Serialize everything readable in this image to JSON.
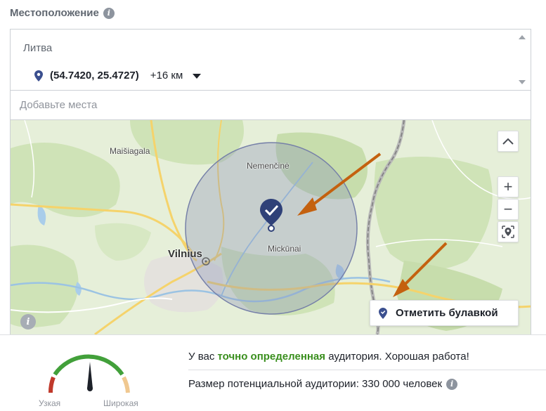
{
  "section": {
    "title": "Местоположение",
    "info_icon": "info-icon"
  },
  "location": {
    "country": "Литва",
    "coords": "(54.7420, 25.4727)",
    "radius": "+16 км",
    "pin_icon": "map-pin-icon"
  },
  "add_places": {
    "placeholder": "Добавьте места"
  },
  "map": {
    "labels": {
      "maisiagala": "Maišiagala",
      "nemencine": "Nemenčinė",
      "vilnius": "Vilnius",
      "mickunai": "Mickūnai"
    },
    "controls": {
      "collapse": "⌃",
      "zoom_in": "+",
      "zoom_out": "−"
    },
    "drop_pin_label": "Отметить булавкой",
    "colors": {
      "radius_fill": "#8a93b8",
      "pin": "#3b4f8f",
      "arrow": "#c4610f"
    }
  },
  "audience": {
    "gauge_narrow": "Узкая",
    "gauge_wide": "Широкая",
    "message_prefix": "У вас ",
    "message_highlight": "точно определенная",
    "message_suffix": " аудитория. Хорошая работа!",
    "size_text": "Размер потенциальной аудитории: 330 000 человек",
    "colors": {
      "good": "#3a8f1e",
      "narrow": "#c0392b",
      "wide": "#f0c890"
    }
  }
}
